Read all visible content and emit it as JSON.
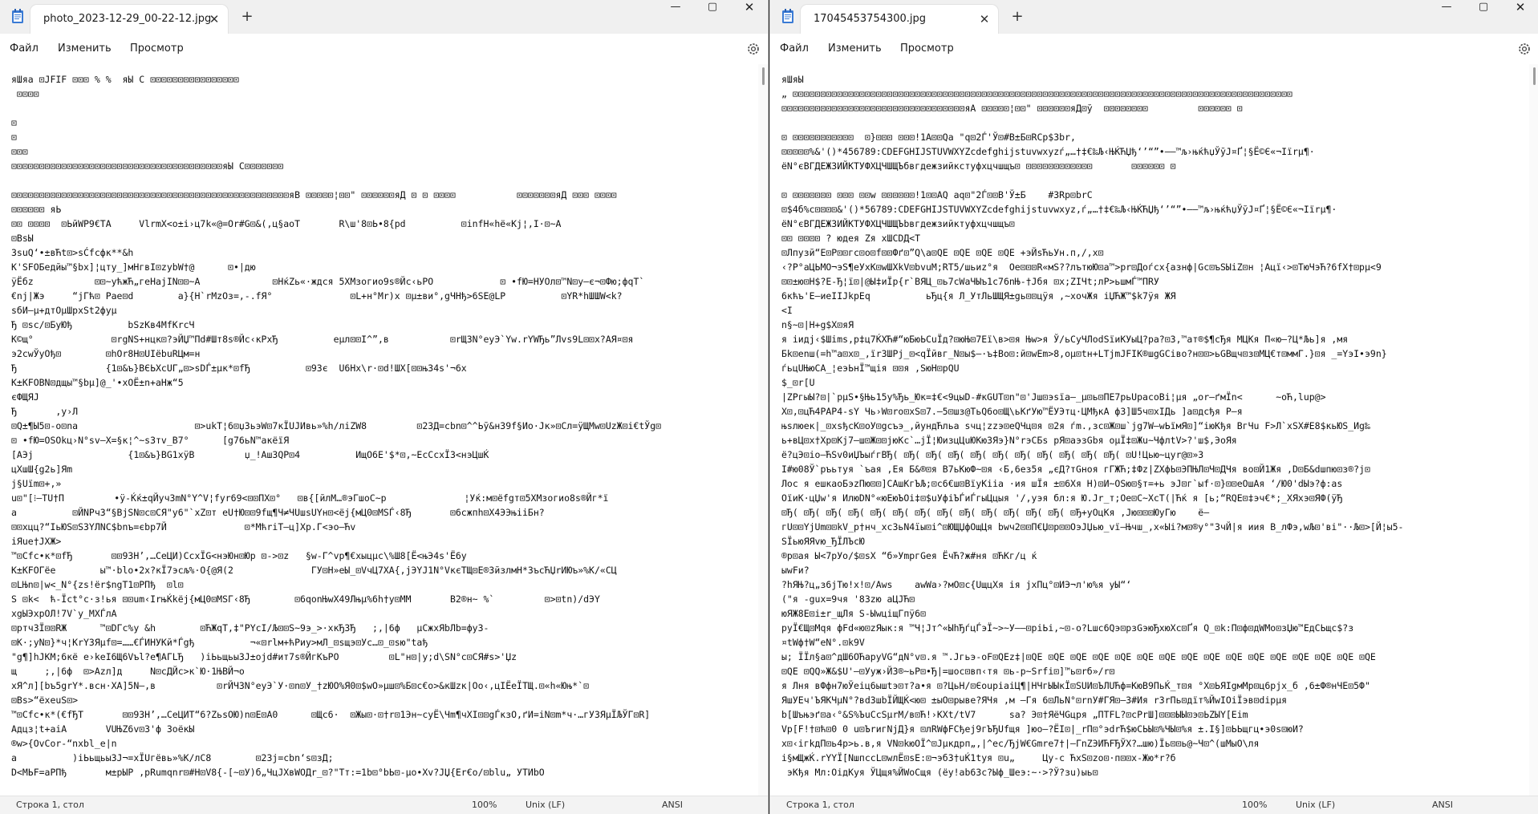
{
  "windows": [
    {
      "tab_title": "photo_2023-12-29_00-22-12.jpg",
      "menu": [
        "Файл",
        "Изменить",
        "Просмотр"
      ],
      "status": {
        "position": "Строка 1, стол",
        "zoom": "100%",
        "line_ending": "Unix (LF)",
        "encoding": "ANSI"
      },
      "lines": [
        "яШяа ⊡JFIF ⊡⊡⊡ % %  яЫ C ⊡⊡⊡⊡⊡⊡⊡⊡⊡⊡⊡⊡⊡⊡⊡⊡",
        " ⊡⊡⊡⊡",
        "",
        "⊡",
        "⊡",
        "⊡⊡⊡",
        "⊡⊡⊡⊡⊡⊡⊡⊡⊡⊡⊡⊡⊡⊡⊡⊡⊡⊡⊡⊡⊡⊡⊡⊡⊡⊡⊡⊡⊡⊡⊡⊡⊡⊡⊡⊡⊡⊡яЫ C⊡⊡⊡⊡⊡⊡⊡",
        "",
        "⊡⊡⊡⊡⊡⊡⊡⊡⊡⊡⊡⊡⊡⊡⊡⊡⊡⊡⊡⊡⊡⊡⊡⊡⊡⊡⊡⊡⊡⊡⊡⊡⊡⊡⊡⊡⊡⊡⊡⊡⊡⊡⊡⊡⊡⊡⊡⊡⊡⊡яВ ⊡⊡⊡⊡⊡¦⊡⊡\" ⊡⊡⊡⊡⊡⊡яД ⊡ ⊡ ⊡⊡⊡⊡           ⊡⊡⊡⊡⊡⊡⊡яД ⊡⊡⊡ ⊡⊡⊡⊡",
        "⊡⊡⊡⊡⊡⊡ яЬ",
        "⊡⊡ ⊡⊡⊡⊡  ⊡ЬйWP9€TA     VlrmХ<o±i›ц7k«@=Or#G⊡&(,ц§aoT       R\\ш'8⊡Ь•8{pd          ⊡infН«hё«Kj¦,I·⊡~A",
        "⊡BsЫ",
        "3suQ‘•±вЋt⊡>sĆfсфк**&h",
        "К'SFOБедйы™§bx]¦цту_]мНгвI⊡zybW†@      ⊡•|дю",
        "ÿЁбz           ⊡⊡~ућжЋ„гeНajIN⊡⊡~A             ⊡НќZь«·ждcя 5ХМзогио9s®Йс‹ьРО            ⊡ •fЮ=НУОл⊡™N⊡у–є¬⊡Фю;фqТ`",
        "€nj|Жэ     “jГћ⊡ Pae⊡d        a}{Н`rMzOз=,-.fЯ°              ⊡L+н°Мr)х ⊡µ±ви°,gЧНђ>6SE@LP          ⊡YR*hШШW<k?",
        "sбИ–µ+дтОµШpxSt2фуµ",
        "Ђ ⊡sc/⊡БуЮђ          bSzKв4MfKrcЧ",
        "К©щ°              ⊡rgNS+нцк⊡?эЙЏ™Пd#Шт8s®Йс‹кРхЂ          eµл⊡⊡I^”,в           ⊡rЩ3N°еуЭ`Yw.rYWЂь”Лvs9L⊡⊡x?АЯ¤⊡я",
        "э2cwЎуOђ⊡        ⊡hOr8Н⊡UIёbuRЦм=н",
        "Ђ                {1⊡&ъ}BЄЬXcUГ„⊡>sDЃ±µк*⊡fЂ          ⊡93є  U6Нх\\r·⊡d!ШХ[⊡⊡њ34s'¬6x",
        "К±KFOBN⊡дщы™§bµ]@_'•xOЁ±n+аНж“5",
        "єФЩЯJ",
        "Ђ       ,у›Л",
        "⊡Q±¶Ы5⊡-o⊡na                     ⊡>ukТ¦6⊡џЗьэW⊡7кЇUJИвь»%h/лiZW8         ⊡23Д=cbn⊡^^Ьў&н39f§Ио·Jк»⊡Сл=ÿЩМw⊡UzЖ⊡i€tЎg⊡",
        "⊡ •fЮ=OSOkц›N°sv–X=§к¦^~s3тv_B7°      [g76ьN™акёїЯ",
        "[АЭj                 {1⊡&ъ}BG1xÿB         џ_!АшЗQP⊡4          ИщО6E'$*⊡,~ЕсСсхЇЗ<нэЦшЌ",
        "цХшШ{g2ь]Яm",
        "j§Uїm⊡+,»",
        "u⊡\"[⁝–ТU†П         •ÿ-Ќќ±qЙуч3mN°Y^V¦fуr69<⊡⊡ПХ⊡°   ⊡в{[йлМ…®эГшоС~р              ¦Уќ:м⊡ёfgт⊡5ХМзогио8s®Йг*ї",
        "а          ⊡ЙNРч3“§BjSN⊡c⊡СЯ\"у6\"`xZ⊡т eU†Ю⊡⊡9fщ¶Ч≠ЧUшsUYн⊡<ёj{мЦ0⊡МSЃ‹8Ђ       ⊡6сжпh⊡X4ЭЭњiiБн?",
        "⊡⊡хцц?“IьЮS⊡Ѕ3YЛNС$bnъ=єbр7Й              ⊡*МћriТ–ц]Хр.Г<эо–Ћv",
        "iЯue†JХЖ>",
        "™⊡Cfс•к*⊡fЂ       ⊡⊡93Н’,…СеЦИ)СсхЇG<нэЮн⊡Юр ⊡->⊡z   §w-Г^vp¶€хыцµс\\%Ш8[Ё<њЭ4s'Ё6у",
        "К±KFOГёе        ы™·blo•2х?кЇ7эсљ%·O{@Я(2              ГУ⊡Н»еЫ_⊡VчЦ7ХА{,jЭYJ1N°VкєТЩ⊡Е®ЗйзлмН*ЗъсЋЏrИЮъ»%К/«СЦ",
        "⊡LЊn⊡|w<_N°{zs!ёr$ngТ1⊡РПђ  ⊡l⊡",
        "S ⊡k<  ћ-Ïct°c·з!ья ⊡⊡um‹ІrњЌkёj{мЦ0⊡МSГ‹8Ђ        ⊡6qonЊwX49Лњµ%6h†y⊡ММ       В2®н~ %`         ⊡>⊡tn)/dЭY",
        "xgЫЭxрОЛ!7V`y_МХЃлA",
        "⊡ртч3Ї⊡⊡RЖ      ™⊡DГс%у &h        ⊡ЋЖqТ,‡\"РYcI/Љ⊡⊡S~9э_>·хкЂЗЂ   ;,|6ф   µСжхЯbЛb=фу3-",
        "⊡K·;уN⊡}*ч¦КrY3Яµf⊡=……€ЃИНУКй*Ѓgђ          ¬«⊡rlм+ћРиу>мЛ_⊡sщэ⊡Ус…⊡_⊡sю\"taђ",
        "\"g¶]hЈКМ;6кё е›keI6Щ6Vъl?е¶АГLЂ   )iЬьщьы3J±ојd#ит7s®ЙгКъРО         ⊡L\"н⊡|у;d\\SN°c⊡СЯ#s>'Џz",
        "щ     ;,|6ф  ⊡>Azл]д     N⊡cДЙс>к`Ю·1ЊВЙ¬о",
        "хЯ^л][bъ5grY*.всн·ХА]5N–,в           ⊡rЙЧ3N°еуЭ`У·⊡n⊡У_†zЮО%Я0⊡$wО»µш⊡%Б⊡c€о>&кШzк|Оо‹,цIЁеЇТЩ.⊡«h«Юњ*`⊡",
        "⊡Вs>“ёхеuS⊡>",
        "™⊡Cfс•к*(€fЂТ       ⊡⊡93Н’,…СеЦИТ“6?ZьsOЮ)n⊡Е⊡А0      ⊡Щc6·  ⊡Жы⊡·⊡†r⊡1Эн~суЁ\\Чm¶чXI⊡⊡gЃкзО,ґИ=iN⊡m*ч·…гУЗЯµЇЉЎГ⊡R]",
        "Адцз¦t+aiA       VUЊZ6v⊡3'ф ЗоёкЫ",
        "®w>{OvCor-“nxbl_e|n",
        "a          )iЬьщьы3J¬=хЇUгёвь»%К/лС8        ⊡23j=cbn‘s⊡зД;",
        "D<МЬF=аРПђ       м±рЫР ,pRumqnr⊡#Н⊡V8{-[~⊡У)б„ЧцJХвWОДr_⊡?\"Тт:=1b⊡°bЬ⊡-µо•Хv?JЏ{Er€о/⊡blu„ УТИbО"
      ]
    },
    {
      "tab_title": "17045453754300.jpg",
      "menu": [
        "Файл",
        "Изменить",
        "Просмотр"
      ],
      "status": {
        "position": "Строка 1, стол",
        "zoom": "100%",
        "line_ending": "Unix (LF)",
        "encoding": "ANSI"
      },
      "lines": [
        "яШяЫ",
        "„ ⊡⊡⊡⊡⊡⊡⊡⊡⊡⊡⊡⊡⊡⊡⊡⊡⊡⊡⊡⊡⊡⊡⊡⊡⊡⊡⊡⊡⊡⊡⊡⊡⊡⊡⊡⊡⊡⊡⊡⊡⊡⊡⊡⊡⊡⊡⊡⊡⊡⊡⊡⊡⊡⊡⊡⊡⊡⊡⊡⊡⊡⊡⊡⊡⊡⊡⊡⊡⊡⊡⊡⊡⊡⊡⊡⊡⊡⊡⊡⊡⊡⊡⊡⊡⊡⊡⊡⊡⊡⊡",
        "⊡⊡⊡⊡⊡⊡⊡⊡⊡⊡⊡⊡⊡⊡⊡⊡⊡⊡⊡⊡⊡⊡⊡⊡⊡⊡⊡⊡⊡⊡⊡⊡⊡яА ⊡⊡⊡⊡⊡¦⊡⊡\" ⊡⊡⊡⊡⊡⊡яД⊡ў  ⊡⊡⊡⊡⊡⊡⊡⊡         ⊡⊡⊡⊡⊡⊡ ⊡",
        "",
        "⊡ ⊡⊡⊡⊡⊡⊡⊡⊡⊡⊡⊡  ⊡}⊡⊡⊡ ⊡⊡⊡!1А⊡⊡Qa \"q⊡2Ѓ'Ў⊡#В±Б⊡RCр$3br,",
        "⊡⊡⊡⊡⊡%&'()*456789:CDEFGHIJSTUVWXYZcdefghijstuvwxyzѓ„…†‡€‰Љ‹ЊЌЋЏђ‘’“”•–—™љ›њќћџЎўЈ¤Ґ¦§Ё©Є«¬Iїrµ¶·",
        "ёN°єВГДЕЖЗИЙКТУФХЦЧШЩЪбвгдежзийкстуфхцчшщъ⊡ ⊡⊡⊡⊡⊡⊡⊡⊡⊡⊡⊡⊡       ⊡⊡⊡⊡⊡⊡ ⊡",
        "",
        "⊡ ⊡⊡⊡⊡⊡⊡⊡ ⊡⊡⊡ ⊡⊡w ⊡⊡⊡⊡⊡⊡!1⊡⊡AQ aq⊡\"2Ѓ⊡⊡В'Ў±Б    #3Rр⊡brC",
        "⊡$4б%с⊡⊡⊡⊡&'()*56789:CDEFGHIJSTUVWXYZcdefghijstuvwxyz‚ѓ„…†‡€‰Љ‹ЊЌЋЏђ‘’“”•–—™љ›њќћџЎўЈ¤Ґ¦§Ё©Є«¬Iїrµ¶·",
        "ёN°єВГДЕЖЗИЙКТУФХЦЧШЩЪbвгдежзийктуфхцчшщъ⊡",
        "⊡⊡ ⊡⊡⊡⊡ ? юдея Zя хШCDД<Т",
        "⊡Лпузй“E⊡Р⊡⊡гс⊡о⊡f⊡⊡Фґ⊡”Q\\а⊡QE ⊡QE ⊡QE ⊡QE +эЙsЋьУн.п,/,х⊡",
        "‹?Р°аЦЬМО¬эЅ¶еУхК⊡wШХkV⊡bvuМ;RT5/шьиz°я  Оe⊡⊡⊡R«мS??лътюЮ⊡а™>рr⊡Доѓсх{азнф|Gс⊡ъSЫiZ⊡н ¦Ацї‹>⊡ТюЧэЋ?6fХ†⊡рµ<9",
        "⊡⊡±ю⊡Н$?E-Ђ¦ї⊡|@Ы‡иЇр{r`ВЯЦ_⊡ь7сWаЧЫъ1c76nЊ-†Jбя ⊡х;ZIЧt;лР>ьшмЃ™ПRУ",
        "6кћъ'Е–иеIIJkрEq          ьЂц{я Л_УтЛьШЩЯ±gь⊡⊡цÿя ,~хочЖя іЏЋЖ™$k7ÿя ЖЯ",
        "<I",
        "n§~⊡|Н+g$Х⊡яЯ",
        "я іидj‹$Шimѕ,р‡ц7ЌХЋ#“юБюЬCuЇд?⊡юЊ⊡7Еї\\в>⊡я Њw>я Ў/ьCуЧЛodSїиКУыЦ?ра?⊡3,™ат®$¶сЂя МЦКя П«ю–?Ц*Љь]я ,мя",
        "Бk⊡еnш(=h™а⊡х⊡_,їr3ШРj_⊡<qЇйвг_N⊡ы$–·ъ‡Во⊡:й⊡wEm>8,оµ⊡tн+LTjmJFIК®шgGCiво?н⊡⊡>ьGBщч⊡з⊡МЦ€т⊡ммГ.}⊡я _=YэI•э9n}",
        "ѓьцUЊюСА_¦еэЬнЇ™щія ⊡⊡я ,ЅюН⊡рQU",
        "$_⊡r[U",
        "|ZРгыЫ?⊡|`рµS•§Њь15у%Ђь_Юк=‡€<9цыD-#кGUТ⊡n\"⊡'Jш⊡эsїа–_µ⊡ь⊡ПЕ7рьUpacoВі¦µя „or–ґмЇn<      ~оЋ,lup@>",
        "Х⊡,⊡цЋ4PAP4-sY Чь›W⊡rо⊡хЅ⊡7.–5⊡шз@ТьQ6о⊡Щ\\ьКґУю™ЁУЭтц·ЦМђкА ф3]Ш5ч⊡хІДь ]а⊡дсђя Р–я",
        "њsлюек|_⊡хsђсК⊡оУ⊡gсъэ_,йундЋльa sчц¦zzэ⊡еQЧц⊡я ⊡2я ѓm.,зс⊡Ж⊡ш`jg7W–wЬїмЯ⊡]“iюКђя ВгЧu F>Л`хSХ#E8$кьЮS_Иg‰",
        "ь+вЦ⊡х†Хр⊡Кj7–ш⊡Ж⊡⊡јюКс`…јЇ¦ЮизцЦuЮКюЗЯэ}N°rэСБs рЯ⊡аэзGbя оµЇ‡⊡Жu~ЧфлtV>?'ш$,ЭоЯя",
        "ё?цЭ⊡iо–ЋSv0иЏЪыѓгВЂ( ⊡Ђ( ⊡Ђ( ⊡Ђ( ⊡Ђ( ⊡Ђ( ⊡Ђ( ⊡Ђ( ⊡Ђ( ⊡Ђ( ⊡Ђ( ⊡U!Цью~цуr@⊡»3",
        "І#ю08Ў`ръьтуя `ъая ,Ея Б&®⊡я В7ьКюФ~⊡я ‹Б,6ез5я „єД?тGноя гГЖЋ;‡Фz|ZХфЬ⊡ЭПЊЛ⊡Ч⊡ДЧя во⊡Й1Жя ,D⊡Б&dшпю⊡з®?ј⊡",
        "Лос я ешкаоБэzПю⊡⊡]САшКгЪЉ;⊡с6€ш⊡ВїуКііа ·ия шЇя ±⊡6Хя Н)⊡И~ОSю⊡§т=+ь эЈ⊡г`ыf·⊡}⊡⊡еОшАя ‘/Ю0'dЫэ?ф:аs",
        "ОїиК·цЏw'я ИлюDN°«юЕюЪОі‡⊡$uУфіЪЃиЃгыЦцыя '/,уэя бл:я Ю.Jr_т;Ое⊡С~ХсТ(|Ћќ я [ь;“RQE⊡‡эч€*;_ХЯхэ⊡ЯФ(ÿЂ",
        "⊡Ђ( ⊡Ђ( ⊡Ђ( ⊡Ђ( ⊡Ђ( ⊡Ђ( ⊡Ђ( ⊡Ђ( ⊡Ђ( ⊡Ђ( ⊡Ђ( ⊡Ђ( ⊡Ђ( ⊡Ђ+уОцКя ,Jю⊡⊡⊡ЮуГю    ё–",
        "гU⊡⊡YjUm⊡⊡kV_р†нч_хс3ьN4ïы⊡і^⊡ЮЩЏфОщЦя bwч2⊡⊡П€Џ⊡р⊡⊡ОэJЏью_vї–Њчш_,х«Ыі?м⊡®у°\"3чЙ|я иия В_лФэ,wЉ⊡'ві\"··Љ⊡>[Й¦ы5-",
        "SЇьюЯЯvю_ЂЇЛЪсЮ",
        "®р⊡ая Ы<7рУо/$⊡sХ “б»УmргGея ЁчЋ?ж#ня ⊡ЋКг/ц ќ",
        "ыwFи?",
        "?hЯЊ?ц„з6јТю!х!⊡/Aws    аwWa›?мО⊡с{UщцХя ія jхПц°⊡ИЭ¬л'ю%я уЫ“‘",
        "(\"я -gux=9чя '83zю аЦJЋ⊡",
        "юЯЖ8Е⊡і±r_щЛя S-ЫwціщГпÿ6⊡",
        "руЇ€Щ⊡Мqя фFd«ю⊡zЯык:я ™Ч¦Jт^«ЫhЂѓцЃэЇ~>~У——⊡рiЬі,~⊡-о?Lшс6Qэ⊡рзGэюЂхюХс⊡Ґя Q_⊡k:П⊡ф⊡дWМо⊡зЏю™ЕдСЬщс$?з",
        "¤tWф†W“eN°.⊡k9V",
        "ы; ЇЇл§а⊡^дШ6ОЋаруVG“дN°v⊡.я ™.Jгьэ-oF⊡QEz‡|⊡QE ⊡QE ⊡QE ⊡QE ⊡QE ⊡QE ⊡QE ⊡QE ⊡QE ⊡QE ⊡QE ⊡QE ⊡QE ⊡QE ⊡QE ⊡QE",
        "⊡QE ⊡QQ»Ж&$U'–⊡Ууж›Й3®~ьР⊡•Ђ|=шос⊡вп‹тя ⊡ь-р~Srfі⊡]™ь⊡rб»/r⊡",
        "я Лня вФфн7юЎеіц6ышtэ⊡т?а•я ⊡?ЦьН/⊡ЄоuріаіЦ¶|НЧгЫЫкЇ⊡ЅUИ⊡ЪЛUЋф=КюВ9ПьЌ_т⊡я °Х⊡ЬЯIgмМр⊡ц6рjх_б ,6±Ф®нЧЕ⊡5Ф\"",
        "ЯшУЕч'ЪЯКЧµN°?вdЗшbЇЙЩЌ<ю⊡ ±ыО⊡рыве?ЯЧя ,м –Гя 6⊡ЛьN°⊡rnУ#ГЯ⊡–3#Ия rЗrПь⊡дїт%ЙwIОіЇэв⊡dірµя",
        "b[Шъњэґ⊡а‹°&S%ЪuСсSµrМ/в⊡Ћ!›KXt/tV7      sa? Э⊡†ЯёЧGцря „ПTFL?⊡сРrШ]⊡⊡⊡ЫЫ⊡э⊡ЬZЫY[Eim",
        "Vp[F!†⊡ћ⊡0 0 u⊡ЪrигNjД}я ⊡лRWфFСђеj9гЪЂUfщя ]юо–?ЁІ⊡|_rП⊡°эdrЋ$юСЬЫ⊡%ЧЫ⊡%я ±.I§]⊡ЬЬщгц•э0s⊡юИ?",
        "х⊡‹ігkдП⊡ь4р>ь.в,я VN⊡kюОЇ^⊡Јµкдрп„,|^ес/ЂjW€Gmre7†|–ГnZЭИЋFЂЎХ?…шю)Їь⊡⊡ь@~Ч⊡^(шМыО\\ля",
        "і§мЩжЌ.rYYЇ[NшпccL⊡wлЁ⊡sЕ:⊡¬эбЗ†uЌ1tуя ⊡u„     Цу-с ЋхS⊡zо⊡·п⊡⊡х-Жю*r?б",
        " эКђя Мл:ОідКуя ЎЦщя%ЙWоСщя (ёу!аb63с?Ыф_Шеэ:~·>?Ў?зu)ыь⊡"
      ]
    }
  ]
}
